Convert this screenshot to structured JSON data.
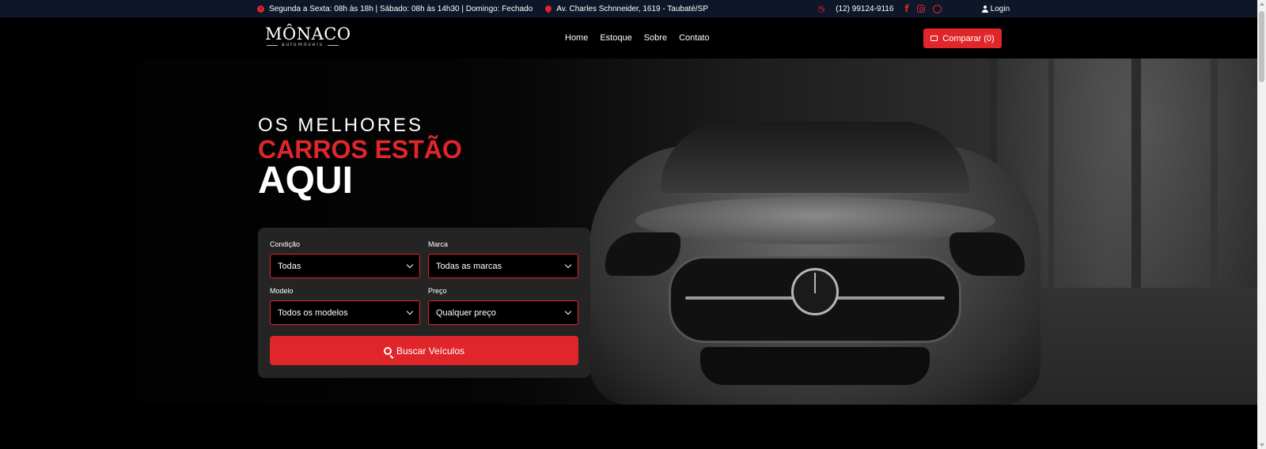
{
  "topbar": {
    "hours": "Segunda a Sexta: 08h às 18h | Sábado: 08h às 14h30 | Domingo: Fechado",
    "address": "Av. Charles Schnneider, 1619 - Taubaté/SP",
    "phone": "(12) 99124-9116",
    "login": "Login"
  },
  "nav": {
    "logo_brand": "MÔNACO",
    "logo_sub": "automóveis",
    "menu": [
      "Home",
      "Estoque",
      "Sobre",
      "Contato"
    ],
    "compare": "Comparar (0)"
  },
  "hero": {
    "line1": "OS MELHORES",
    "line2": "CARROS ESTÃO",
    "line3": "AQUI"
  },
  "search": {
    "condition_label": "Condição",
    "condition_value": "Todas",
    "brand_label": "Marca",
    "brand_value": "Todas as marcas",
    "model_label": "Modelo",
    "model_value": "Todos os modelos",
    "price_label": "Preço",
    "price_value": "Qualquer preço",
    "button": "Buscar Veículos"
  },
  "colors": {
    "accent": "#e0262a",
    "topbar_bg": "#0e1629",
    "panel_bg": "#242424"
  },
  "icons": [
    "clock-icon",
    "location-pin-icon",
    "phone-icon",
    "facebook-icon",
    "instagram-icon",
    "whatsapp-icon",
    "user-icon",
    "compare-icon",
    "chevron-down-icon",
    "search-icon"
  ]
}
